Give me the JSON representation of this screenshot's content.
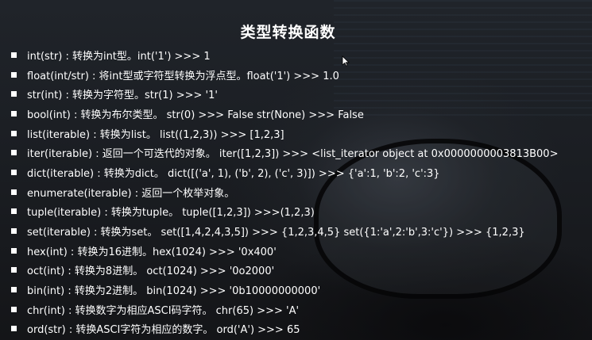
{
  "title": "类型转换函数",
  "items": [
    "int(str) : 转换为int型。int('1') >>> 1",
    "float(int/str) : 将int型或字符型转换为浮点型。float('1') >>> 1.0",
    "str(int) : 转换为字符型。str(1) >>> '1'",
    "bool(int) : 转换为布尔类型。 str(0) >>> False str(None) >>> False",
    "list(iterable) : 转换为list。 list((1,2,3)) >>> [1,2,3]",
    "iter(iterable) :  返回一个可迭代的对象。 iter([1,2,3]) >>> <list_iterator object at 0x0000000003813B00>",
    "dict(iterable) : 转换为dict。 dict([('a', 1), ('b', 2), ('c', 3)]) >>> {'a':1, 'b':2, 'c':3}",
    "enumerate(iterable) : 返回一个枚举对象。",
    "tuple(iterable) : 转换为tuple。 tuple([1,2,3]) >>>(1,2,3)",
    "set(iterable) : 转换为set。 set([1,4,2,4,3,5]) >>> {1,2,3,4,5} set({1:'a',2:'b',3:'c'}) >>> {1,2,3}",
    "hex(int) : 转换为16进制。hex(1024) >>> '0x400'",
    "oct(int) : 转换为8进制。 oct(1024) >>> '0o2000'",
    "bin(int) : 转换为2进制。 bin(1024) >>> '0b10000000000'",
    "chr(int) : 转换数字为相应ASCI码字符。 chr(65) >>> 'A'",
    "ord(str) : 转换ASCI字符为相应的数字。 ord('A') >>> 65"
  ],
  "icons": {
    "bullet": "square-bullet-icon",
    "cursor": "mouse-pointer-icon"
  },
  "colors": {
    "text": "#ffffff",
    "background": "#1c1e22"
  }
}
